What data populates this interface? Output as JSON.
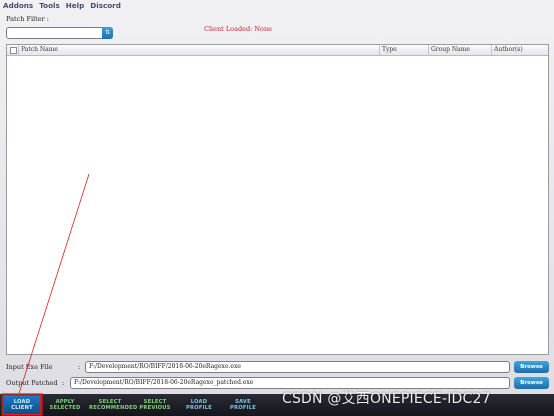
{
  "menubar": {
    "items": [
      "Addons",
      "Tools",
      "Help",
      "Discord"
    ]
  },
  "filter": {
    "label": "Patch Filter :",
    "value": "",
    "button_glyph": "⇅"
  },
  "status": {
    "client_loaded": "Client Loaded: None"
  },
  "table": {
    "columns": [
      "Patch Name",
      "Type",
      "Group Name",
      "Author(s)"
    ],
    "rows": []
  },
  "input_file": {
    "label": "Input Exe File",
    "colon": ":",
    "value": "F:/Development/RO/BIFF/2018-06-20eRagexe.exe",
    "button": "Browse"
  },
  "output_file": {
    "label": "Output Patched",
    "colon": ":",
    "value": "F:/Development/RO/BIFF/2018-06-20eRagexe_patched.exe",
    "button": "Browse"
  },
  "toolbar": {
    "buttons": [
      {
        "line1": "LOAD",
        "line2": "CLIENT"
      },
      {
        "line1": "APPLY",
        "line2": "SELECTED"
      },
      {
        "line1": "SELECT",
        "line2": "RECOMMENDED"
      },
      {
        "line1": "SELECT",
        "line2": "PREVIOUS"
      },
      {
        "line1": "LOAD",
        "line2": "PROFILE"
      },
      {
        "line1": "SAVE",
        "line2": "PROFILE"
      }
    ]
  },
  "watermark": "CSDN @艾西ONEPIECE-IDC27",
  "colors": {
    "accent": "#1f6fae",
    "status_red": "#c0262c",
    "annotation": "#e02020"
  },
  "icons": {
    "filter_button": "sort-icon",
    "header_checkbox": "checkbox-icon"
  }
}
